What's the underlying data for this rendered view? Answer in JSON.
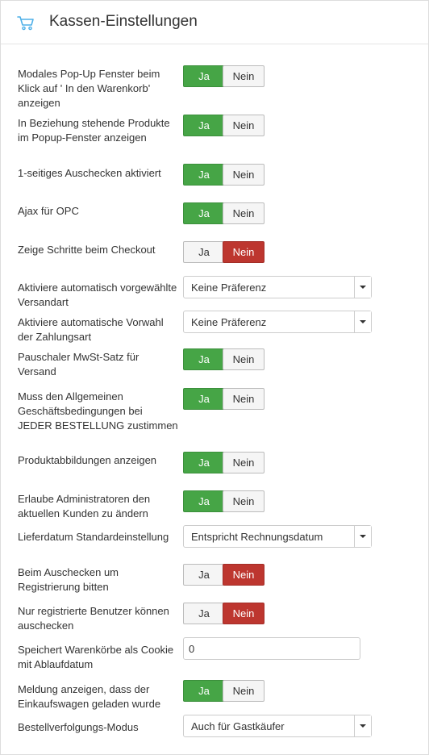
{
  "header": {
    "title": "Kassen-Einstellungen",
    "icon": "cart-icon",
    "icon_color": "#4fb0e8"
  },
  "options": {
    "ja": "Ja",
    "nein": "Nein"
  },
  "settings": [
    {
      "label": "Modales Pop-Up Fenster beim Klick auf ' In den Warenkorb' anzeigen",
      "type": "toggle",
      "value": "ja"
    },
    {
      "label": "In Beziehung stehende Produkte im Popup-Fenster anzeigen",
      "type": "toggle",
      "value": "ja"
    },
    {
      "label": "1-seitiges Auschecken aktiviert",
      "type": "toggle",
      "value": "ja"
    },
    {
      "label": "Ajax für OPC",
      "type": "toggle",
      "value": "ja"
    },
    {
      "label": "Zeige Schritte beim Checkout",
      "type": "toggle",
      "value": "nein"
    },
    {
      "label": "Aktiviere automatisch vorgewählte Versandart",
      "type": "select",
      "value": "Keine Präferenz"
    },
    {
      "label": "Aktiviere automatische Vorwahl der Zahlungsart",
      "type": "select",
      "value": "Keine Präferenz"
    },
    {
      "label": "Pauschaler MwSt-Satz für Versand",
      "type": "toggle",
      "value": "ja"
    },
    {
      "label": "Muss den Allgemeinen Geschäftsbedingungen bei JEDER BESTELLUNG zustimmen",
      "type": "toggle",
      "value": "ja"
    },
    {
      "label": "Produktabbildungen anzeigen",
      "type": "toggle",
      "value": "ja"
    },
    {
      "label": "Erlaube Administratoren den aktuellen Kunden zu ändern",
      "type": "toggle",
      "value": "ja"
    },
    {
      "label": "Lieferdatum Standardeinstellung",
      "type": "select",
      "value": "Entspricht Rechnungsdatum"
    },
    {
      "label": "Beim Auschecken um Registrierung bitten",
      "type": "toggle",
      "value": "nein"
    },
    {
      "label": "Nur registrierte Benutzer können auschecken",
      "type": "toggle",
      "value": "nein"
    },
    {
      "label": "Speichert Warenkörbe als Cookie mit Ablaufdatum",
      "type": "text",
      "value": "0"
    },
    {
      "label": "Meldung anzeigen, dass der Einkaufswagen geladen wurde",
      "type": "toggle",
      "value": "ja"
    },
    {
      "label": "Bestellverfolgungs-Modus",
      "type": "select",
      "value": "Auch für Gastkäufer"
    }
  ],
  "colors": {
    "yes_active": "#46a546",
    "no_active": "#bd362f",
    "inactive": "#f5f5f5"
  }
}
